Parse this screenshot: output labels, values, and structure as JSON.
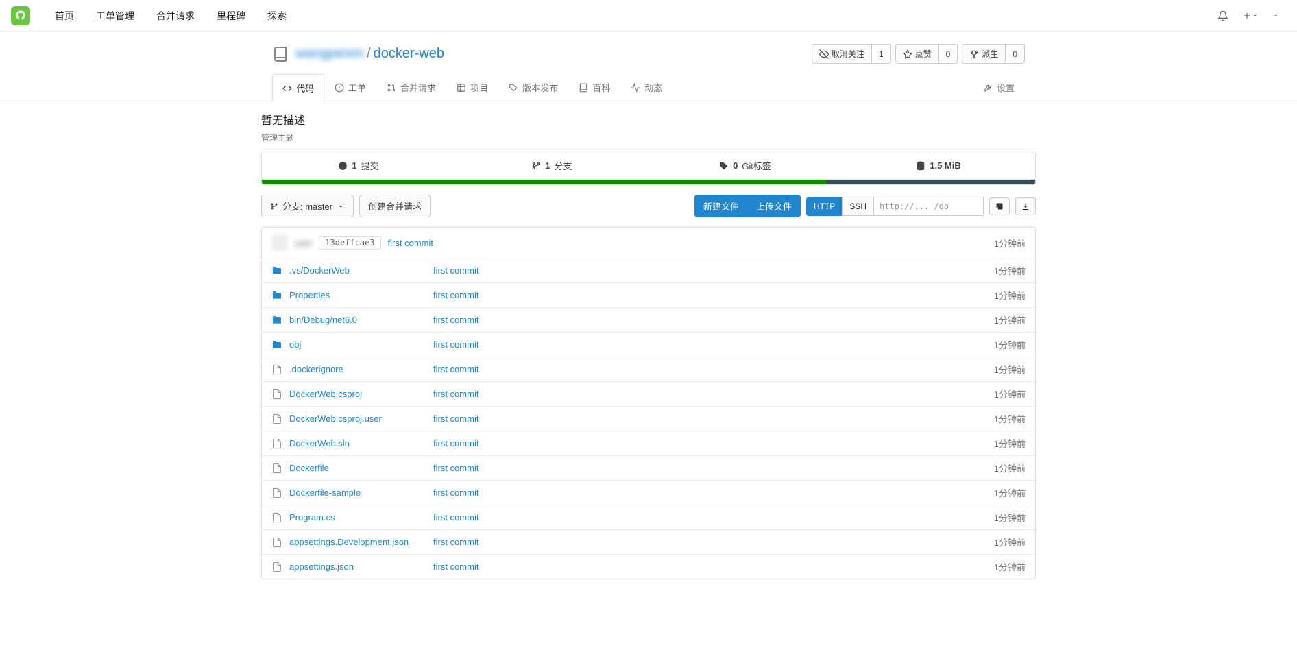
{
  "nav": {
    "items": [
      "首页",
      "工单管理",
      "合并请求",
      "里程碑",
      "探索"
    ]
  },
  "repo": {
    "owner": "wangpeixin",
    "name": "docker-web",
    "actions": [
      {
        "label": "取消关注",
        "count": "1",
        "icon": "eye-off"
      },
      {
        "label": "点赞",
        "count": "0",
        "icon": "star"
      },
      {
        "label": "派生",
        "count": "0",
        "icon": "fork"
      }
    ]
  },
  "tabs": {
    "items": [
      {
        "label": "代码",
        "icon": "code",
        "active": true
      },
      {
        "label": "工单",
        "icon": "issue"
      },
      {
        "label": "合并请求",
        "icon": "git-pr"
      },
      {
        "label": "项目",
        "icon": "project"
      },
      {
        "label": "版本发布",
        "icon": "tag"
      },
      {
        "label": "百科",
        "icon": "book"
      },
      {
        "label": "动态",
        "icon": "activity"
      }
    ],
    "settings": "设置"
  },
  "desc": {
    "text": "暂无描述",
    "manage": "管理主题"
  },
  "stats": {
    "commits_n": "1",
    "commits_l": "提交",
    "branches_n": "1",
    "branches_l": "分支",
    "tags_n": "0",
    "tags_l": "Git标签",
    "size": "1.5 MiB"
  },
  "toolbar": {
    "branch": "分支: master",
    "new_pr": "创建合并请求",
    "new_file": "新建文件",
    "upload": "上传文件",
    "http": "HTTP",
    "ssh": "SSH",
    "clone_url": "http://... /do"
  },
  "commit": {
    "author": "user",
    "sha": "13deffcae3",
    "msg": "first commit",
    "time": "1分钟前"
  },
  "files": [
    {
      "type": "folder",
      "name": ".vs/DockerWeb",
      "msg": "first commit",
      "time": "1分钟前"
    },
    {
      "type": "folder",
      "name": "Properties",
      "msg": "first commit",
      "time": "1分钟前"
    },
    {
      "type": "folder",
      "name": "bin/Debug/net6.0",
      "msg": "first commit",
      "time": "1分钟前"
    },
    {
      "type": "folder",
      "name": "obj",
      "msg": "first commit",
      "time": "1分钟前"
    },
    {
      "type": "file",
      "name": ".dockerignore",
      "msg": "first commit",
      "time": "1分钟前"
    },
    {
      "type": "file",
      "name": "DockerWeb.csproj",
      "msg": "first commit",
      "time": "1分钟前"
    },
    {
      "type": "file",
      "name": "DockerWeb.csproj.user",
      "msg": "first commit",
      "time": "1分钟前"
    },
    {
      "type": "file",
      "name": "DockerWeb.sln",
      "msg": "first commit",
      "time": "1分钟前"
    },
    {
      "type": "file",
      "name": "Dockerfile",
      "msg": "first commit",
      "time": "1分钟前"
    },
    {
      "type": "file",
      "name": "Dockerfile-sample",
      "msg": "first commit",
      "time": "1分钟前"
    },
    {
      "type": "file",
      "name": "Program.cs",
      "msg": "first commit",
      "time": "1分钟前"
    },
    {
      "type": "file",
      "name": "appsettings.Development.json",
      "msg": "first commit",
      "time": "1分钟前"
    },
    {
      "type": "file",
      "name": "appsettings.json",
      "msg": "first commit",
      "time": "1分钟前"
    }
  ]
}
